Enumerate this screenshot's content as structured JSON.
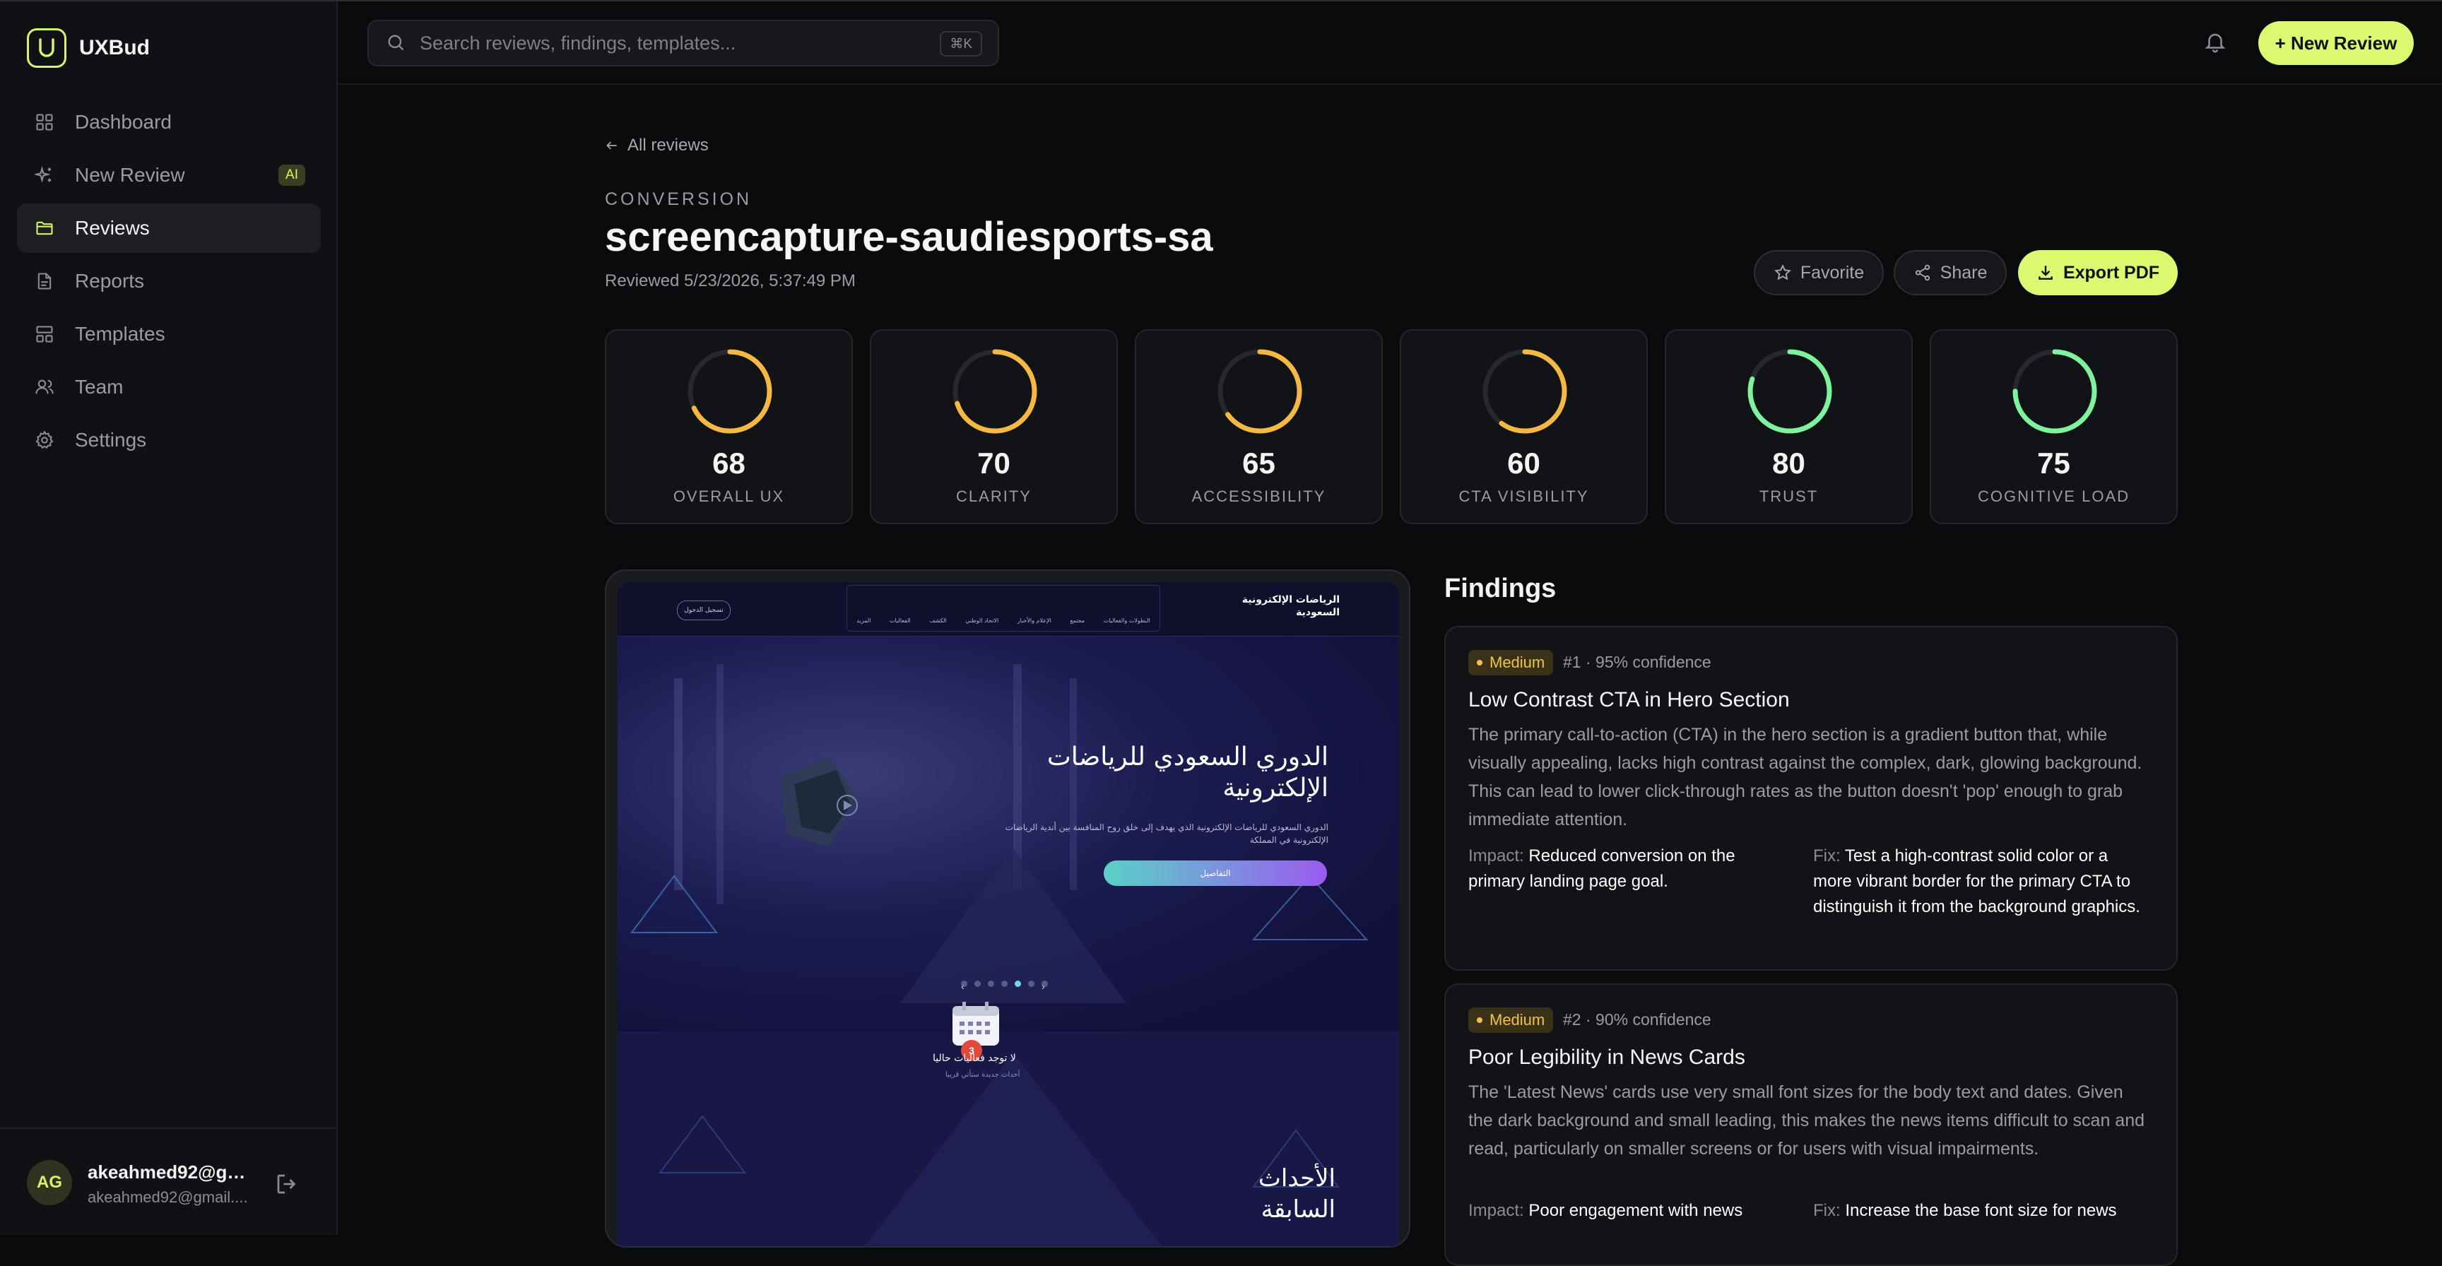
{
  "app": {
    "name": "UXBud"
  },
  "sidebar": {
    "items": [
      {
        "label": "Dashboard",
        "icon": "grid-icon"
      },
      {
        "label": "New Review",
        "icon": "sparkle-icon",
        "badge": "AI"
      },
      {
        "label": "Reviews",
        "icon": "folder-icon",
        "active": true
      },
      {
        "label": "Reports",
        "icon": "document-icon"
      },
      {
        "label": "Templates",
        "icon": "layout-icon"
      },
      {
        "label": "Team",
        "icon": "users-icon"
      },
      {
        "label": "Settings",
        "icon": "gear-icon"
      }
    ],
    "user": {
      "initials": "AG",
      "name": "akeahmed92@gm...",
      "email": "akeahmed92@gmail...."
    }
  },
  "header": {
    "search_placeholder": "Search reviews, findings, templates...",
    "shortcut": "⌘K",
    "new_review_label": "+ New Review"
  },
  "review": {
    "back_label": "All reviews",
    "category": "CONVERSION",
    "title": "screencapture-saudiesports-sa",
    "reviewed": "Reviewed 5/23/2026, 5:37:49 PM",
    "actions": {
      "favorite": "Favorite",
      "share": "Share",
      "export": "Export PDF"
    }
  },
  "colors": {
    "accent": "#dcf870",
    "score_mid": "#f5b942",
    "score_good": "#7ef29d",
    "severity_medium": "#f0c24a"
  },
  "scores": [
    {
      "value": 68,
      "label": "OVERALL UX"
    },
    {
      "value": 70,
      "label": "CLARITY"
    },
    {
      "value": 65,
      "label": "ACCESSIBILITY"
    },
    {
      "value": 60,
      "label": "CTA VISIBILITY"
    },
    {
      "value": 80,
      "label": "TRUST"
    },
    {
      "value": 75,
      "label": "COGNITIVE LOAD"
    }
  ],
  "preview": {
    "logo": "الرياضات الإلكترونية\nالسعودية",
    "login": "تسجيل الدخول",
    "menu": [
      "المزيد",
      "الفعاليات",
      "الكشف",
      "الاتحاد الوطني",
      "الإعلام والأخبار",
      "مجتمع",
      "البطولات والفعاليات"
    ],
    "hero_title": "الدوري السعودي للرياضات\nالإلكترونية",
    "hero_sub": "الدوري السعودي للرياضات الإلكترونية الذي يهدف إلى خلق روح المنافسة بين أندية الرياضات الإلكترونية في المملكة",
    "cta": "التفاصيل",
    "no_events": "لا توجد فعاليات حاليا",
    "no_events_sub": "أحداث جديدة ستأتي قريبا",
    "badge": "3",
    "events_title": "الأحداث\nالسابقة"
  },
  "findings": {
    "title": "Findings",
    "items": [
      {
        "severity": "Medium",
        "meta": "#1 · 95% confidence",
        "title": "Low Contrast CTA in Hero Section",
        "body": "The primary call-to-action (CTA) in the hero section is a gradient button that, while visually appealing, lacks high contrast against the complex, dark, glowing background. This can lead to lower click-through rates as the button doesn't 'pop' enough to grab immediate attention.",
        "impact_label": "Impact:",
        "impact": "Reduced conversion on the primary landing page goal.",
        "fix_label": "Fix:",
        "fix": "Test a high-contrast solid color or a more vibrant border for the primary CTA to distinguish it from the background graphics."
      },
      {
        "severity": "Medium",
        "meta": "#2 · 90% confidence",
        "title": "Poor Legibility in News Cards",
        "body": "The 'Latest News' cards use very small font sizes for the body text and dates. Given the dark background and small leading, this makes the news items difficult to scan and read, particularly on smaller screens or for users with visual impairments.",
        "impact_label": "Impact:",
        "impact": "Poor engagement with news",
        "fix_label": "Fix:",
        "fix": "Increase the base font size for news"
      }
    ]
  }
}
